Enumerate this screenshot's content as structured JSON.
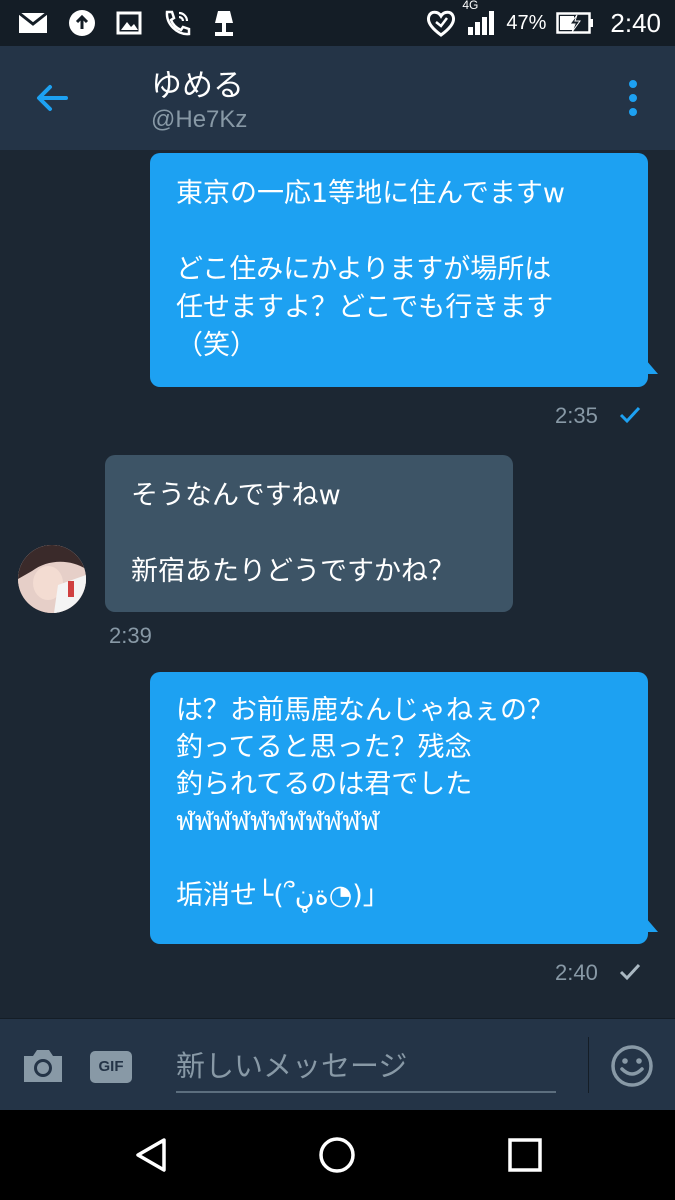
{
  "status_bar": {
    "network": "4G",
    "battery": "47%",
    "time": "2:40",
    "icons": [
      "gmail-icon",
      "upload-icon",
      "image-icon",
      "phone-call-icon",
      "lamp-icon",
      "heart-shield-icon",
      "signal-icon",
      "battery-charging-icon"
    ]
  },
  "header": {
    "name": "ゆめる",
    "handle": "@He7Kz",
    "back_icon": "arrow-left-icon",
    "menu_icon": "more-vertical-icon"
  },
  "messages": [
    {
      "direction": "outgoing",
      "text": "東京の一応1等地に住んでますw\n\nどこ住みにかよりますが場所は\n任せますよ？どこでも行きます\n（笑）",
      "time": "2:35",
      "status_icon": "check-icon",
      "status_color": "#1da1f2"
    },
    {
      "direction": "incoming",
      "text": "そうなんですねw\n\n新宿あたりどうですかね？",
      "time": "2:39"
    },
    {
      "direction": "outgoing",
      "text": "は？お前馬鹿なんじゃねぇの？\n釣ってると思った？残念\n釣られてるのは君でした\nฬฬฬฬฬฬฬฬฬฬฬ\n\n垢消せ└(՞ةڼ◔)」",
      "time": "2:40",
      "status_icon": "check-icon",
      "status_color": "#aab8c2"
    }
  ],
  "composer": {
    "placeholder": "新しいメッセージ",
    "gif_label": "GIF",
    "camera_icon": "camera-icon",
    "emoji_icon": "emoji-icon"
  },
  "colors": {
    "accent": "#1da1f2",
    "background": "#1c2733",
    "header": "#243447",
    "incoming_bubble": "#3d5466",
    "muted_text": "#8899a6"
  }
}
